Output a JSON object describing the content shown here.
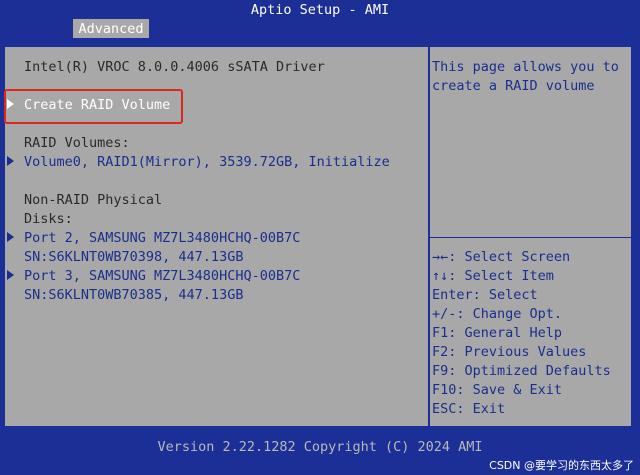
{
  "app_title": "Aptio Setup - AMI",
  "tab": "Advanced",
  "main": {
    "driver_title": "Intel(R) VROC 8.0.0.4006 sSATA Driver",
    "create_raid": "Create RAID Volume",
    "raid_volumes_label": "RAID Volumes:",
    "volume0": "Volume0, RAID1(Mirror), 3539.72GB, Initialize",
    "non_raid_label_1": "Non-RAID Physical",
    "non_raid_label_2": "Disks:",
    "disk1_line1": "Port 2, SAMSUNG MZ7L3480HCHQ-00B7C",
    "disk1_line2": "SN:S6KLNT0WB70398, 447.13GB",
    "disk2_line1": "Port 3, SAMSUNG MZ7L3480HCHQ-00B7C",
    "disk2_line2": "SN:S6KLNT0WB70385, 447.13GB"
  },
  "help": {
    "line1": "This page allows you to",
    "line2": "create a RAID volume"
  },
  "keys": [
    "→←: Select Screen",
    "↑↓: Select Item",
    "Enter: Select",
    "+/-: Change Opt.",
    "F1: General Help",
    "F2: Previous Values",
    "F9: Optimized Defaults",
    "F10: Save & Exit",
    "ESC: Exit"
  ],
  "footer": "Version 2.22.1282 Copyright (C) 2024 AMI",
  "watermark": "CSDN @要学习的东西太多了"
}
